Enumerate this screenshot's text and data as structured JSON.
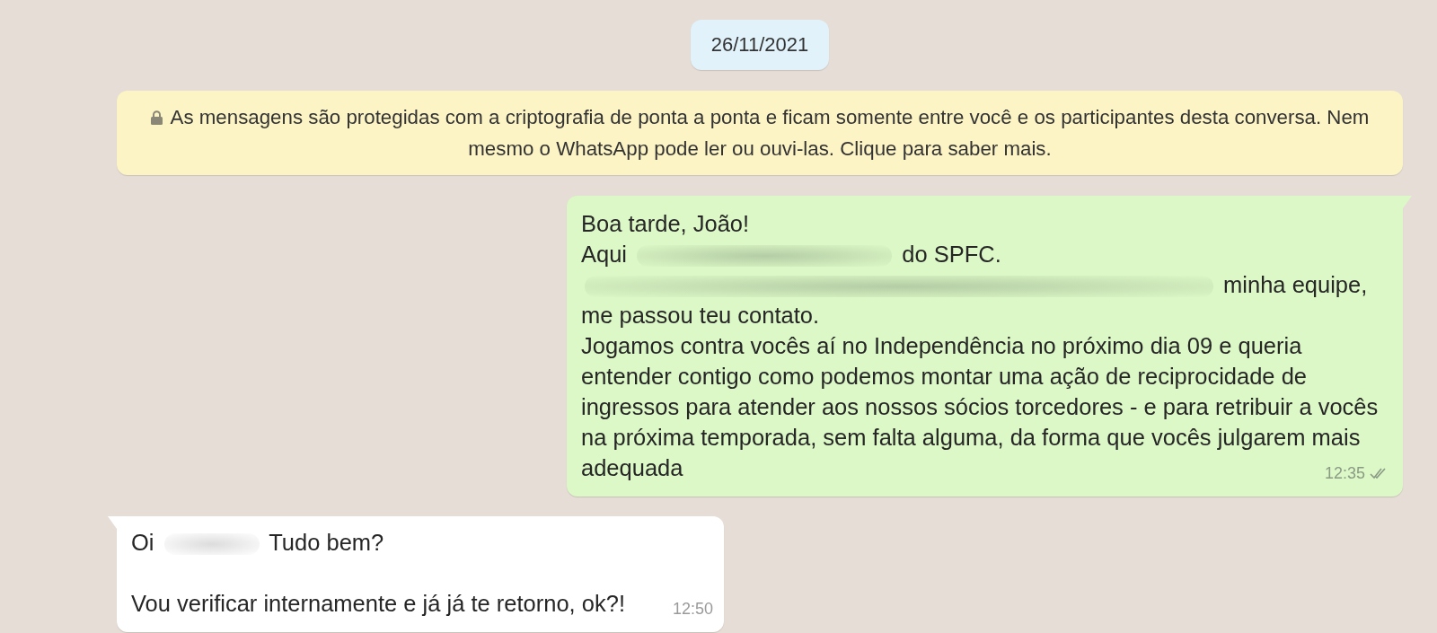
{
  "date_chip": {
    "text": "26/11/2021"
  },
  "encryption_notice": {
    "text": "As mensagens são protegidas com a criptografia de ponta a ponta e ficam somente entre você e os participantes desta conversa. Nem mesmo o WhatsApp pode ler ou ouvi-las. Clique para saber mais."
  },
  "messages": [
    {
      "kind": "outgoing",
      "read": false,
      "time": "12:35",
      "paragraphs": [
        {
          "lines": [
            [
              {
                "kind": "text",
                "text": "Boa tarde, João!"
              }
            ],
            [
              {
                "kind": "text",
                "text": "Aqui"
              },
              {
                "kind": "blurred"
              },
              {
                "kind": "text",
                "text": "do SPFC."
              }
            ],
            [
              {
                "kind": "blurred"
              },
              {
                "kind": "text",
                "text": "minha equipe,"
              }
            ],
            [
              {
                "kind": "text",
                "text": "me passou teu contato."
              }
            ],
            [
              {
                "kind": "text",
                "text": "Jogamos contra vocês aí no Independência no próximo dia 09 e queria"
              }
            ],
            [
              {
                "kind": "text",
                "text": "entender contigo como podemos montar uma ação de reciprocidade de"
              }
            ],
            [
              {
                "kind": "text",
                "text": "ingressos para atender aos nossos sócios torcedores - e para retribuir a vocês"
              }
            ],
            [
              {
                "kind": "text",
                "text": "na próxima temporada, sem falta alguma, da forma que vocês julgarem mais"
              }
            ],
            [
              {
                "kind": "text",
                "text": "adequada"
              }
            ]
          ]
        }
      ]
    },
    {
      "kind": "incoming",
      "time": "12:50",
      "paragraphs": [
        {
          "lines": [
            [
              {
                "kind": "text",
                "text": "Oi"
              },
              {
                "kind": "blurred"
              },
              {
                "kind": "text",
                "text": "Tudo bem?"
              }
            ]
          ]
        },
        {
          "lines": [
            [
              {
                "kind": "text",
                "text": "Vou verificar internamente e já já te retorno, ok?!"
              }
            ]
          ]
        }
      ]
    }
  ]
}
